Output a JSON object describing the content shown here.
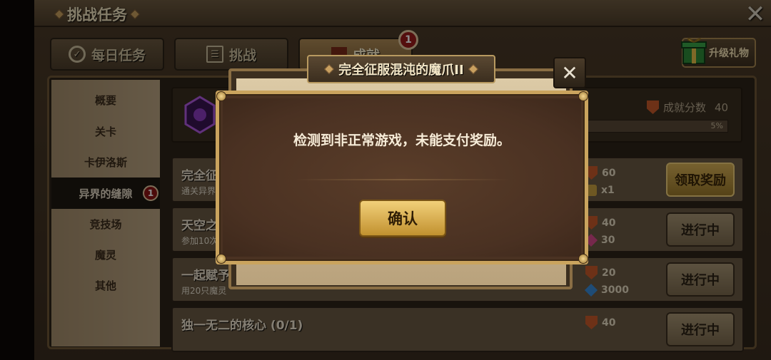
{
  "header": {
    "title": "挑战任务",
    "close_icon": "close-icon"
  },
  "tabs": [
    {
      "label": "每日任务",
      "icon": "check-circle-icon"
    },
    {
      "label": "挑战",
      "icon": "list-icon"
    },
    {
      "label": "成就",
      "icon": "trophy-icon",
      "badge": "1"
    }
  ],
  "gift": {
    "label": "升级礼物",
    "icon": "gift-icon"
  },
  "sidebar": {
    "items": [
      {
        "label": "概要"
      },
      {
        "label": "关卡"
      },
      {
        "label": "卡伊洛斯"
      },
      {
        "label": "异界的缝隙",
        "badge": "1",
        "active": true
      },
      {
        "label": "竞技场"
      },
      {
        "label": "魔灵"
      },
      {
        "label": "其他"
      }
    ]
  },
  "summary": {
    "score_label": "成就分数",
    "score_value": "40",
    "progress_text": "5%",
    "progress_fraction": 0.05
  },
  "tasks": [
    {
      "title": "完全征",
      "desc": "通关异界",
      "reward1": "60",
      "reward2": "x1",
      "button": "领取奖励"
    },
    {
      "title": "天空之",
      "desc": "参加10次",
      "reward1": "40",
      "reward2": "30",
      "button": "进行中"
    },
    {
      "title": "一起赋予",
      "desc": "用20只魔灵",
      "reward1": "20",
      "reward2": "3000",
      "button": "进行中"
    },
    {
      "title": "独一无二的核心 (0/1)",
      "desc": "",
      "reward1": "40",
      "reward2": "",
      "button": "进行中"
    }
  ],
  "modal": {
    "title": "完全征服混沌的魔爪II",
    "message": "检测到非正常游戏，未能支付奖励。",
    "confirm": "确认"
  },
  "colors": {
    "accent_gold": "#caa45e",
    "badge_red": "#9a1a1a",
    "panel_brown": "#4a3222"
  }
}
